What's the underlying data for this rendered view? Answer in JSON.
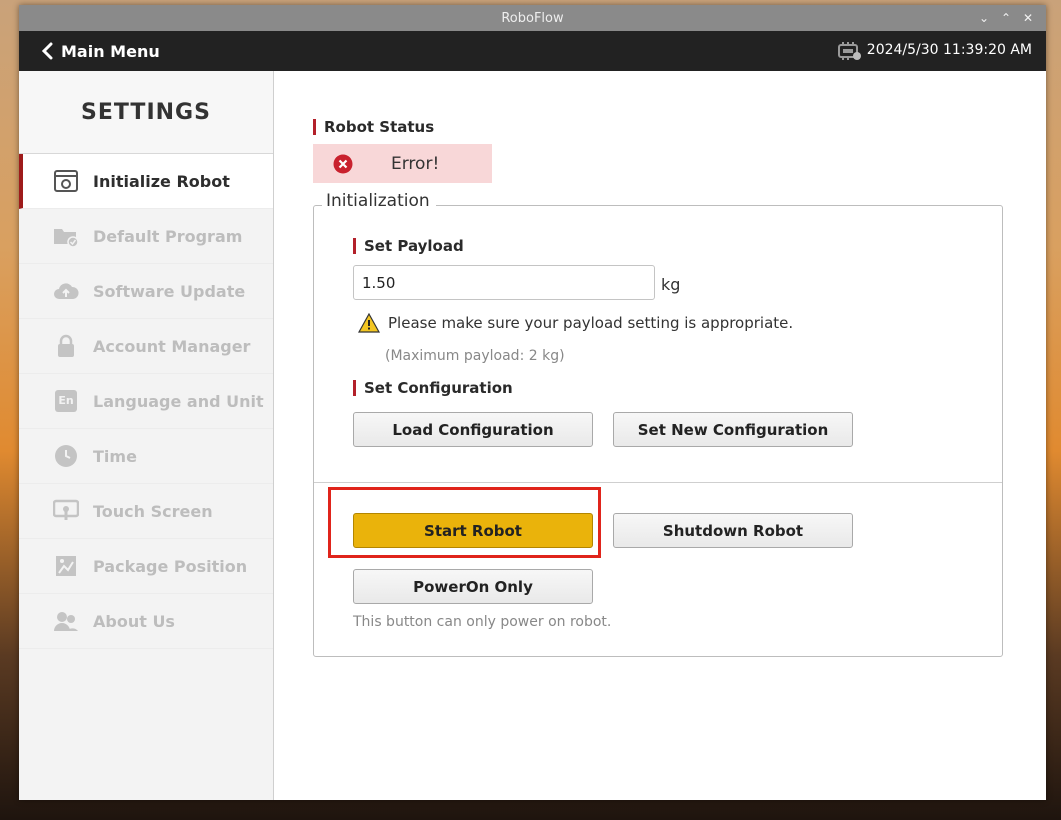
{
  "window": {
    "title": "RoboFlow"
  },
  "header": {
    "back_label": "Main Menu",
    "datetime": "2024/5/30 11:39:20 AM"
  },
  "sidebar": {
    "title": "SETTINGS",
    "items": [
      {
        "label": "Initialize Robot",
        "icon": "initialize-icon",
        "active": true
      },
      {
        "label": "Default Program",
        "icon": "folder-check-icon"
      },
      {
        "label": "Software Update",
        "icon": "cloud-upload-icon"
      },
      {
        "label": "Account Manager",
        "icon": "lock-icon"
      },
      {
        "label": "Language and Unit",
        "icon": "language-icon",
        "badge": "En"
      },
      {
        "label": "Time",
        "icon": "clock-icon"
      },
      {
        "label": "Touch Screen",
        "icon": "touch-screen-icon"
      },
      {
        "label": "Package Position",
        "icon": "package-position-icon"
      },
      {
        "label": "About Us",
        "icon": "users-icon"
      }
    ]
  },
  "robot_status": {
    "label": "Robot Status",
    "value": "Error!"
  },
  "initialization": {
    "legend": "Initialization",
    "payload": {
      "label": "Set Payload",
      "value": "1.50",
      "unit": "kg",
      "warning": "Please make sure your payload setting is appropriate.",
      "hint": "(Maximum payload: 2 kg)"
    },
    "configuration": {
      "label": "Set Configuration",
      "load_button": "Load Configuration",
      "new_button": "Set New Configuration"
    },
    "start_button": "Start Robot",
    "shutdown_button": "Shutdown Robot",
    "poweron_button": "PowerOn Only",
    "poweron_note": "This button can only power on robot."
  },
  "colors": {
    "accent_red": "#b3202a",
    "start_yellow": "#eab30b",
    "error_bg": "#f8d7d8",
    "highlight": "#e0241b"
  }
}
